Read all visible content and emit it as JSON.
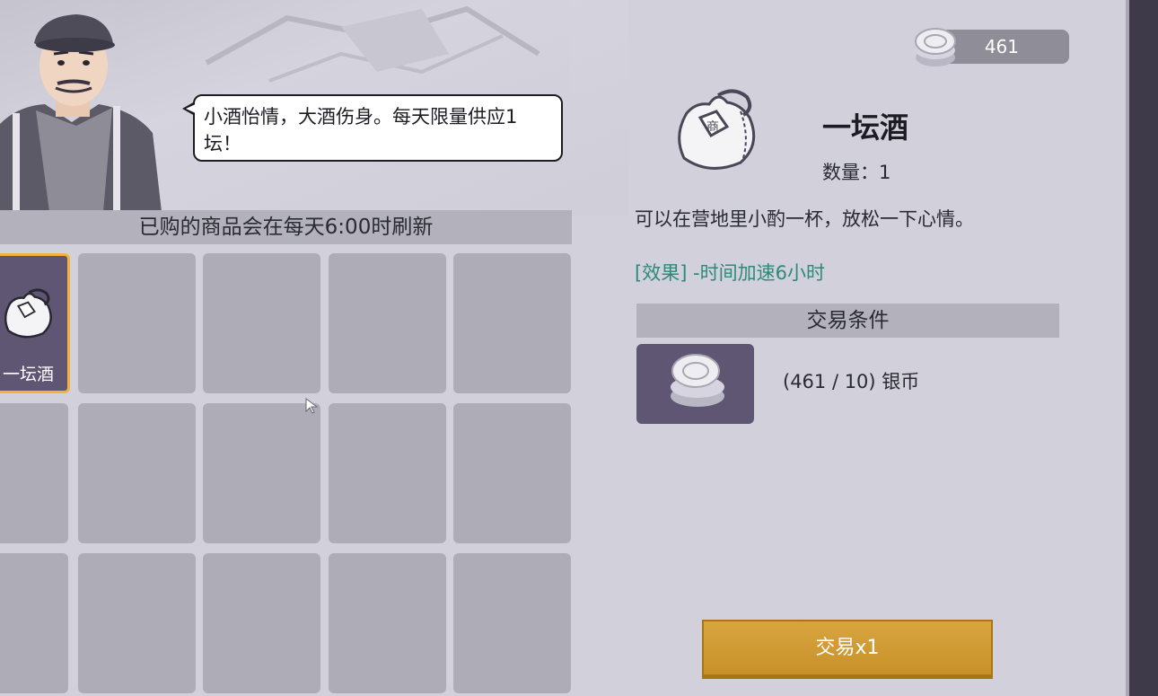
{
  "npc": {
    "speech": "小酒怡情，大酒伤身。每天限量供应1坛！"
  },
  "shop": {
    "refresh_notice": "已购的商品会在每天6:00时刷新",
    "slots": [
      {
        "label": "一坛酒",
        "selected": true
      },
      {
        "label": ""
      },
      {
        "label": ""
      },
      {
        "label": ""
      },
      {
        "label": ""
      },
      {
        "label": ""
      },
      {
        "label": ""
      },
      {
        "label": ""
      },
      {
        "label": ""
      },
      {
        "label": ""
      },
      {
        "label": ""
      },
      {
        "label": ""
      },
      {
        "label": ""
      },
      {
        "label": ""
      },
      {
        "label": ""
      }
    ]
  },
  "currency": {
    "silver": "461"
  },
  "item": {
    "name": "一坛酒",
    "quantity": "数量：1",
    "description": "可以在营地里小酌一杯，放松一下心情。",
    "effect": "[效果] -时间加速6小时"
  },
  "trade": {
    "conditions_header": "交易条件",
    "cost_text": "(461 / 10) 银币",
    "button_label": "交易x1"
  },
  "colors": {
    "accent_gold": "#d7a53e",
    "effect_green": "#2c8a78",
    "slot_selected": "#5e5672",
    "selected_border": "#f2b33d"
  }
}
